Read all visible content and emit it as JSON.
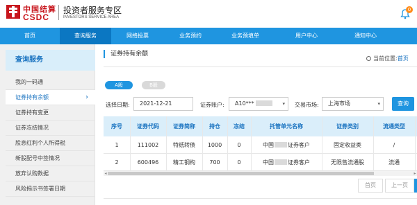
{
  "header": {
    "logo_cn": "中国结算",
    "logo_en": "CSDC",
    "zone_title": "投资者服务专区",
    "zone_subtitle": "INVESTORS SERVICE AREA",
    "notification_count": "0",
    "brand_color": "#c8161d"
  },
  "nav": {
    "items": [
      {
        "label": "首页"
      },
      {
        "label": "查询服务"
      },
      {
        "label": "网络投票"
      },
      {
        "label": "业务预约"
      },
      {
        "label": "业务预填单"
      },
      {
        "label": "用户中心"
      },
      {
        "label": "通知中心"
      }
    ],
    "active_index": 1,
    "accent_color": "#1f95e0"
  },
  "sidebar": {
    "title": "查询服务",
    "items": [
      {
        "label": "我的一码通"
      },
      {
        "label": "证券持有余额"
      },
      {
        "label": "证券持有变更"
      },
      {
        "label": "证券冻结情况"
      },
      {
        "label": "股息红利个人所得税"
      },
      {
        "label": "新股配号中签情况"
      },
      {
        "label": "放弃认购数据"
      },
      {
        "label": "风险揭示书签署日期"
      }
    ],
    "active_index": 1,
    "active_arrow": "›"
  },
  "main": {
    "title": "证券持有余额",
    "location_label": "当前位置:",
    "location_home": "首页",
    "tabs": [
      {
        "label": "A股",
        "active": true
      },
      {
        "label": "B股",
        "active": false
      }
    ],
    "filters": {
      "date_label": "选择日期:",
      "date_value": "2021-12-21",
      "account_label": "证券账户:",
      "account_value": "A10***",
      "market_label": "交易市场:",
      "market_value": "上海市场",
      "query_button": "查询"
    },
    "table": {
      "columns": [
        "序号",
        "证券代码",
        "证券简称",
        "持仓",
        "冻结",
        "托管单元名称",
        "证券类别",
        "流通类型"
      ],
      "rows": [
        {
          "no": "1",
          "code": "111002",
          "name": "特纸转债",
          "hold": "1000",
          "frozen": "0",
          "custodian_prefix": "中国",
          "custodian_suffix": "证券客户",
          "category": "固定收益类",
          "circulation": "/"
        },
        {
          "no": "2",
          "code": "600496",
          "name": "精工钢构",
          "hold": "700",
          "frozen": "0",
          "custodian_prefix": "中国",
          "custodian_suffix": "证券客户",
          "category": "无限售流通股",
          "circulation": "流通"
        }
      ]
    },
    "pager": {
      "first": "首页",
      "prev": "上一页"
    }
  }
}
